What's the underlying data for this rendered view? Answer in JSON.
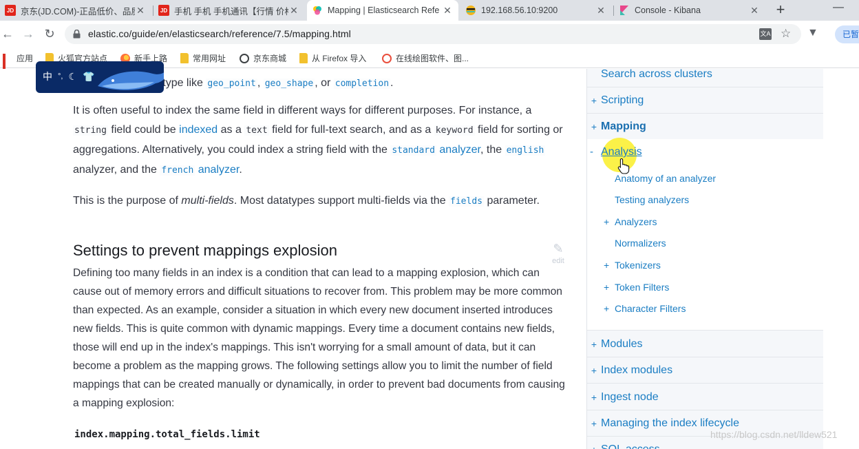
{
  "tabs": [
    {
      "title": "京东(JD.COM)-正品低价、品质",
      "favicon": "JD",
      "color": "#e1251b"
    },
    {
      "title": "手机 手机 手机通讯【行情 价格",
      "favicon": "JD",
      "color": "#e1251b"
    },
    {
      "title": "Mapping | Elasticsearch Refe",
      "favicon": "elastic",
      "color": "#22a6a8"
    },
    {
      "title": "192.168.56.10:9200",
      "favicon": "es",
      "color": "#3b82f6"
    },
    {
      "title": "Console - Kibana",
      "favicon": "K",
      "color": "#e8478b"
    }
  ],
  "toolbar": {
    "url": "elastic.co/guide/en/elasticsearch/reference/7.5/mapping.html",
    "profile_label": "已暂"
  },
  "bookmarks": [
    {
      "label": "应用",
      "icon": "apps-grid-icon"
    },
    {
      "label": "火狐官方站点",
      "icon": "folder-icon"
    },
    {
      "label": "新手上路",
      "icon": "firefox-icon"
    },
    {
      "label": "常用网址",
      "icon": "folder-icon"
    },
    {
      "label": "京东商城",
      "icon": "globe-icon"
    },
    {
      "label": "从 Firefox 导入",
      "icon": "folder-icon"
    },
    {
      "label": "在线绘图软件、图...",
      "icon": "processon-icon"
    }
  ],
  "ime": {
    "label": "中"
  },
  "content": {
    "p0_pre": "ed type like ",
    "code_geo_point": "geo_point",
    "p0_comma": ", ",
    "code_geo_shape": "geo_shape",
    "p0_or": ", or ",
    "code_completion": "completion",
    "p0_end": ".",
    "p1_a": "It is often useful to index the same field in different ways for different purposes. For instance, a ",
    "code_string": "string",
    "p1_b": " field could be ",
    "link_indexed": "indexed",
    "p1_c": " as a ",
    "code_text": "text",
    "p1_d": " field for full-text search, and as a ",
    "code_keyword": "keyword",
    "p1_e": " field for sorting or aggregations. Alternatively, you could index a string field with the ",
    "code_standard": "standard",
    "link_analyzer1": " analyzer",
    "p1_f": ", the ",
    "code_english": "english",
    "p1_g": " analyzer, and the ",
    "code_french": "french",
    "link_analyzer2": " analyzer",
    "p1_h": ".",
    "p2_a": "This is the purpose of ",
    "p2_em": "multi-fields",
    "p2_b": ". Most datatypes support multi-fields via the ",
    "code_fields": "fields",
    "p2_c": " parameter.",
    "h2": "Settings to prevent mappings explosion",
    "p3": "Defining too many fields in an index is a condition that can lead to a mapping explosion, which can cause out of memory errors and difficult situations to recover from. This problem may be more common than expected. As an example, consider a situation in which every new document inserted introduces new fields. This is quite common with dynamic mappings. Every time a document contains new fields, those will end up in the index's mappings. This isn't worrying for a small amount of data, but it can become a problem as the mapping grows. The following settings allow you to limit the number of field mappings that can be created manually or dynamically, in order to prevent bad documents from causing a mapping explosion:",
    "setting": "index.mapping.total_fields.limit",
    "edit_label": "edit"
  },
  "sidenav": {
    "top_items": [
      {
        "label": "Search across clusters",
        "prefix": ""
      },
      {
        "label": "Scripting",
        "prefix": "+"
      },
      {
        "label": "Mapping",
        "prefix": "+"
      }
    ],
    "expanded": {
      "label": "Analysis",
      "prefix": "-",
      "children": [
        {
          "label": "Anatomy of an analyzer",
          "prefix": ""
        },
        {
          "label": "Testing analyzers",
          "prefix": ""
        },
        {
          "label": "Analyzers",
          "prefix": "+"
        },
        {
          "label": "Normalizers",
          "prefix": ""
        },
        {
          "label": "Tokenizers",
          "prefix": "+"
        },
        {
          "label": "Token Filters",
          "prefix": "+"
        },
        {
          "label": "Character Filters",
          "prefix": "+"
        }
      ]
    },
    "bottom_items": [
      {
        "label": "Modules",
        "prefix": "+"
      },
      {
        "label": "Index modules",
        "prefix": "+"
      },
      {
        "label": "Ingest node",
        "prefix": "+"
      },
      {
        "label": "Managing the index lifecycle",
        "prefix": "+"
      },
      {
        "label": "SQL access",
        "prefix": "+"
      }
    ]
  },
  "watermark": "https://blog.csdn.net/lldew521"
}
